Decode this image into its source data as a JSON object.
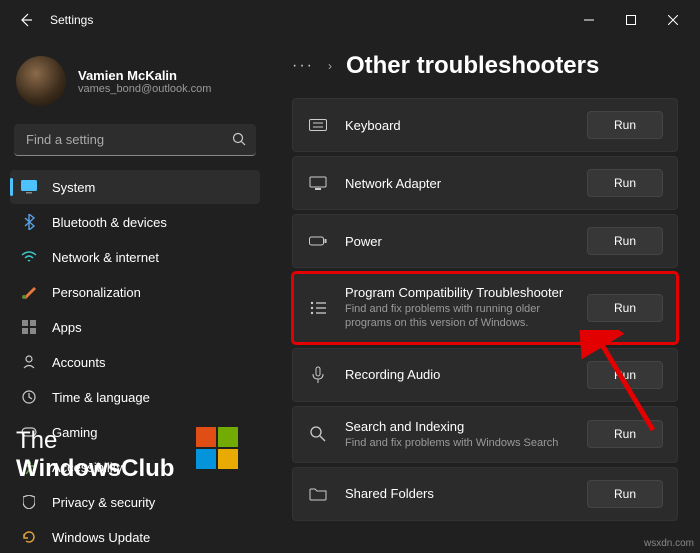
{
  "titlebar": {
    "title": "Settings"
  },
  "user": {
    "name": "Vamien McKalin",
    "email": "vames_bond@outlook.com"
  },
  "search": {
    "placeholder": "Find a setting"
  },
  "nav": [
    {
      "label": "System"
    },
    {
      "label": "Bluetooth & devices"
    },
    {
      "label": "Network & internet"
    },
    {
      "label": "Personalization"
    },
    {
      "label": "Apps"
    },
    {
      "label": "Accounts"
    },
    {
      "label": "Time & language"
    },
    {
      "label": "Gaming"
    },
    {
      "label": "Accessibility"
    },
    {
      "label": "Privacy & security"
    },
    {
      "label": "Windows Update"
    }
  ],
  "breadcrumb": {
    "dots": "···",
    "current": "Other troubleshooters"
  },
  "items": [
    {
      "title": "Keyboard",
      "run": "Run"
    },
    {
      "title": "Network Adapter",
      "run": "Run"
    },
    {
      "title": "Power",
      "run": "Run"
    },
    {
      "title": "Program Compatibility Troubleshooter",
      "desc": "Find and fix problems with running older programs on this version of Windows.",
      "run": "Run"
    },
    {
      "title": "Recording Audio",
      "run": "Run"
    },
    {
      "title": "Search and Indexing",
      "desc": "Find and fix problems with Windows Search",
      "run": "Run"
    },
    {
      "title": "Shared Folders",
      "run": "Run"
    }
  ],
  "watermark": {
    "line1": "The",
    "line2": "WindowsClub"
  },
  "source": "wsxdn.com"
}
